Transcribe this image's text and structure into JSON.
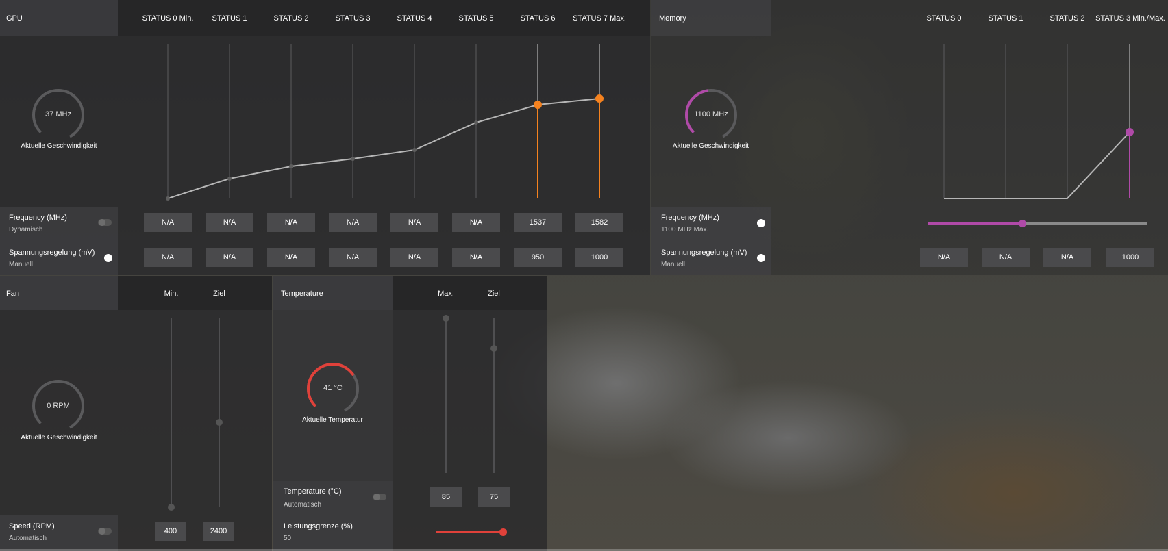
{
  "gpu": {
    "title": "GPU",
    "states": [
      "STATUS 0 Min.",
      "STATUS 1",
      "STATUS 2",
      "STATUS 3",
      "STATUS 4",
      "STATUS 5",
      "STATUS 6",
      "STATUS 7 Max."
    ],
    "gauge_value": "37 MHz",
    "gauge_caption": "Aktuelle Geschwindigkeit",
    "accent_color": "#f5821f",
    "frequency": {
      "label": "Frequency (MHz)",
      "mode": "Dynamisch",
      "values": [
        "N/A",
        "N/A",
        "N/A",
        "N/A",
        "N/A",
        "N/A",
        "1537",
        "1582"
      ]
    },
    "voltage": {
      "label": "Spannungsregelung (mV)",
      "mode": "Manuell",
      "values": [
        "N/A",
        "N/A",
        "N/A",
        "N/A",
        "N/A",
        "N/A",
        "950",
        "1000"
      ]
    }
  },
  "memory": {
    "title": "Memory",
    "states": [
      "STATUS 0",
      "STATUS 1",
      "STATUS 2",
      "STATUS 3 Min./Max."
    ],
    "gauge_value": "1100 MHz",
    "gauge_caption": "Aktuelle Geschwindigkeit",
    "accent_color": "#b04aa8",
    "frequency": {
      "label": "Frequency (MHz)",
      "mode": "1100 MHz Max.",
      "slider_fraction": 0.43
    },
    "voltage": {
      "label": "Spannungsregelung (mV)",
      "mode": "Manuell",
      "values": [
        "N/A",
        "N/A",
        "N/A",
        "1000"
      ]
    }
  },
  "fan": {
    "title": "Fan",
    "columns": [
      "Min.",
      "Ziel"
    ],
    "gauge_value": "0 RPM",
    "gauge_caption": "Aktuelle Geschwindigkeit",
    "speed": {
      "label": "Speed (RPM)",
      "mode": "Automatisch",
      "values": [
        "400",
        "2400"
      ]
    }
  },
  "temperature": {
    "title": "Temperature",
    "columns": [
      "Max.",
      "Ziel"
    ],
    "gauge_value": "41 °C",
    "gauge_caption": "Aktuelle Temperatur",
    "accent_color": "#e0413a",
    "temp_row": {
      "label": "Temperature (°C)",
      "mode": "Automatisch",
      "values": [
        "85",
        "75"
      ]
    },
    "power": {
      "label": "Leistungsgrenze (%)",
      "value": "50"
    }
  },
  "chart_data": {
    "type": "line",
    "categories": [
      "STATUS 0 Min.",
      "STATUS 1",
      "STATUS 2",
      "STATUS 3",
      "STATUS 4",
      "STATUS 5",
      "STATUS 6",
      "STATUS 7 Max."
    ],
    "active_values": [
      null,
      null,
      null,
      null,
      null,
      null,
      1537,
      1582
    ]
  }
}
